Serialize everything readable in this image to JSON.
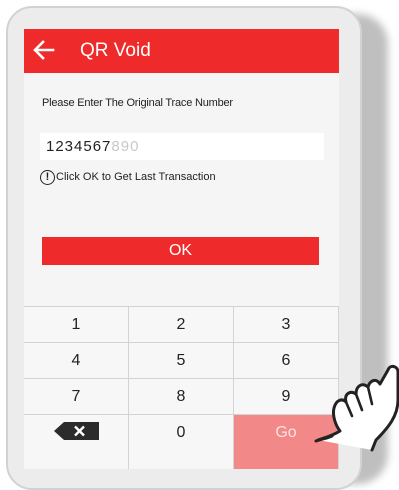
{
  "header": {
    "title": "QR Void"
  },
  "form": {
    "prompt": "Please Enter The Original Trace Number",
    "input_value_typed": "1234567",
    "input_value_faded": "890",
    "hint": "Click OK to Get Last Transaction",
    "ok_label": "OK"
  },
  "keypad": {
    "keys": [
      "1",
      "2",
      "3",
      "4",
      "5",
      "6",
      "7",
      "8",
      "9",
      "",
      "0",
      "Go"
    ]
  },
  "colors": {
    "accent": "#ef2a2a",
    "go_key": "#f28888"
  }
}
